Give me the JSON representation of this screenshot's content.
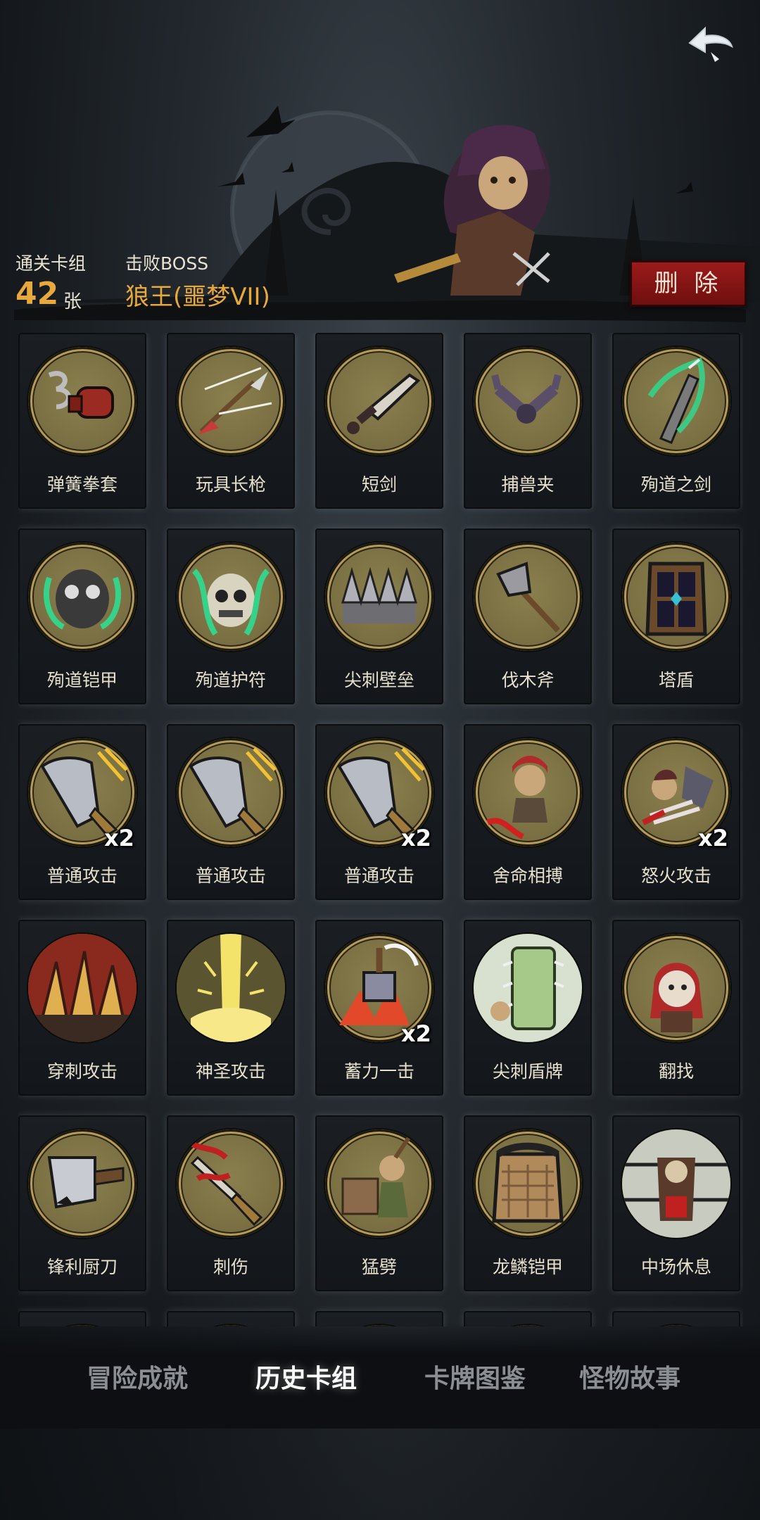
{
  "header": {
    "cleared_deck_label": "通关卡组",
    "cleared_deck_count": "42",
    "cleared_deck_unit": "张",
    "boss_label": "击败BOSS",
    "boss_name": "狼王(噩梦VII)",
    "delete_label": "删 除"
  },
  "cards": [
    {
      "name": "弹簧拳套",
      "icon": "spring-glove-icon",
      "mult": ""
    },
    {
      "name": "玩具长枪",
      "icon": "toy-spear-icon",
      "mult": ""
    },
    {
      "name": "短剑",
      "icon": "short-sword-icon",
      "mult": ""
    },
    {
      "name": "捕兽夹",
      "icon": "bear-trap-icon",
      "mult": ""
    },
    {
      "name": "殉道之剑",
      "icon": "martyr-sword-icon",
      "mult": ""
    },
    {
      "name": "殉道铠甲",
      "icon": "martyr-armor-icon",
      "mult": ""
    },
    {
      "name": "殉道护符",
      "icon": "martyr-amulet-icon",
      "mult": ""
    },
    {
      "name": "尖刺壁垒",
      "icon": "spike-wall-icon",
      "mult": ""
    },
    {
      "name": "伐木斧",
      "icon": "axe-icon",
      "mult": ""
    },
    {
      "name": "塔盾",
      "icon": "tower-shield-icon",
      "mult": ""
    },
    {
      "name": "普通攻击",
      "icon": "sword-attack-icon",
      "mult": "x2"
    },
    {
      "name": "普通攻击",
      "icon": "sword-attack-icon",
      "mult": ""
    },
    {
      "name": "普通攻击",
      "icon": "sword-attack-icon",
      "mult": "x2"
    },
    {
      "name": "舍命相搏",
      "icon": "desperate-fight-icon",
      "mult": ""
    },
    {
      "name": "怒火攻击",
      "icon": "rage-attack-icon",
      "mult": "x2"
    },
    {
      "name": "穿刺攻击",
      "icon": "pierce-attack-icon",
      "mult": ""
    },
    {
      "name": "神圣攻击",
      "icon": "holy-attack-icon",
      "mult": ""
    },
    {
      "name": "蓄力一击",
      "icon": "charged-hammer-icon",
      "mult": "x2"
    },
    {
      "name": "尖刺盾牌",
      "icon": "spike-shield-icon",
      "mult": ""
    },
    {
      "name": "翻找",
      "icon": "search-girl-icon",
      "mult": ""
    },
    {
      "name": "锋利厨刀",
      "icon": "cleaver-icon",
      "mult": ""
    },
    {
      "name": "刺伤",
      "icon": "stab-icon",
      "mult": ""
    },
    {
      "name": "猛劈",
      "icon": "heavy-chop-icon",
      "mult": ""
    },
    {
      "name": "龙鳞铠甲",
      "icon": "dragon-scale-armor-icon",
      "mult": ""
    },
    {
      "name": "中场休息",
      "icon": "intermission-icon",
      "mult": ""
    }
  ],
  "tabs": [
    {
      "label": "冒险成就",
      "active": false
    },
    {
      "label": "历史卡组",
      "active": true
    },
    {
      "label": "卡牌图鉴",
      "active": false
    },
    {
      "label": "怪物故事",
      "active": false
    }
  ]
}
